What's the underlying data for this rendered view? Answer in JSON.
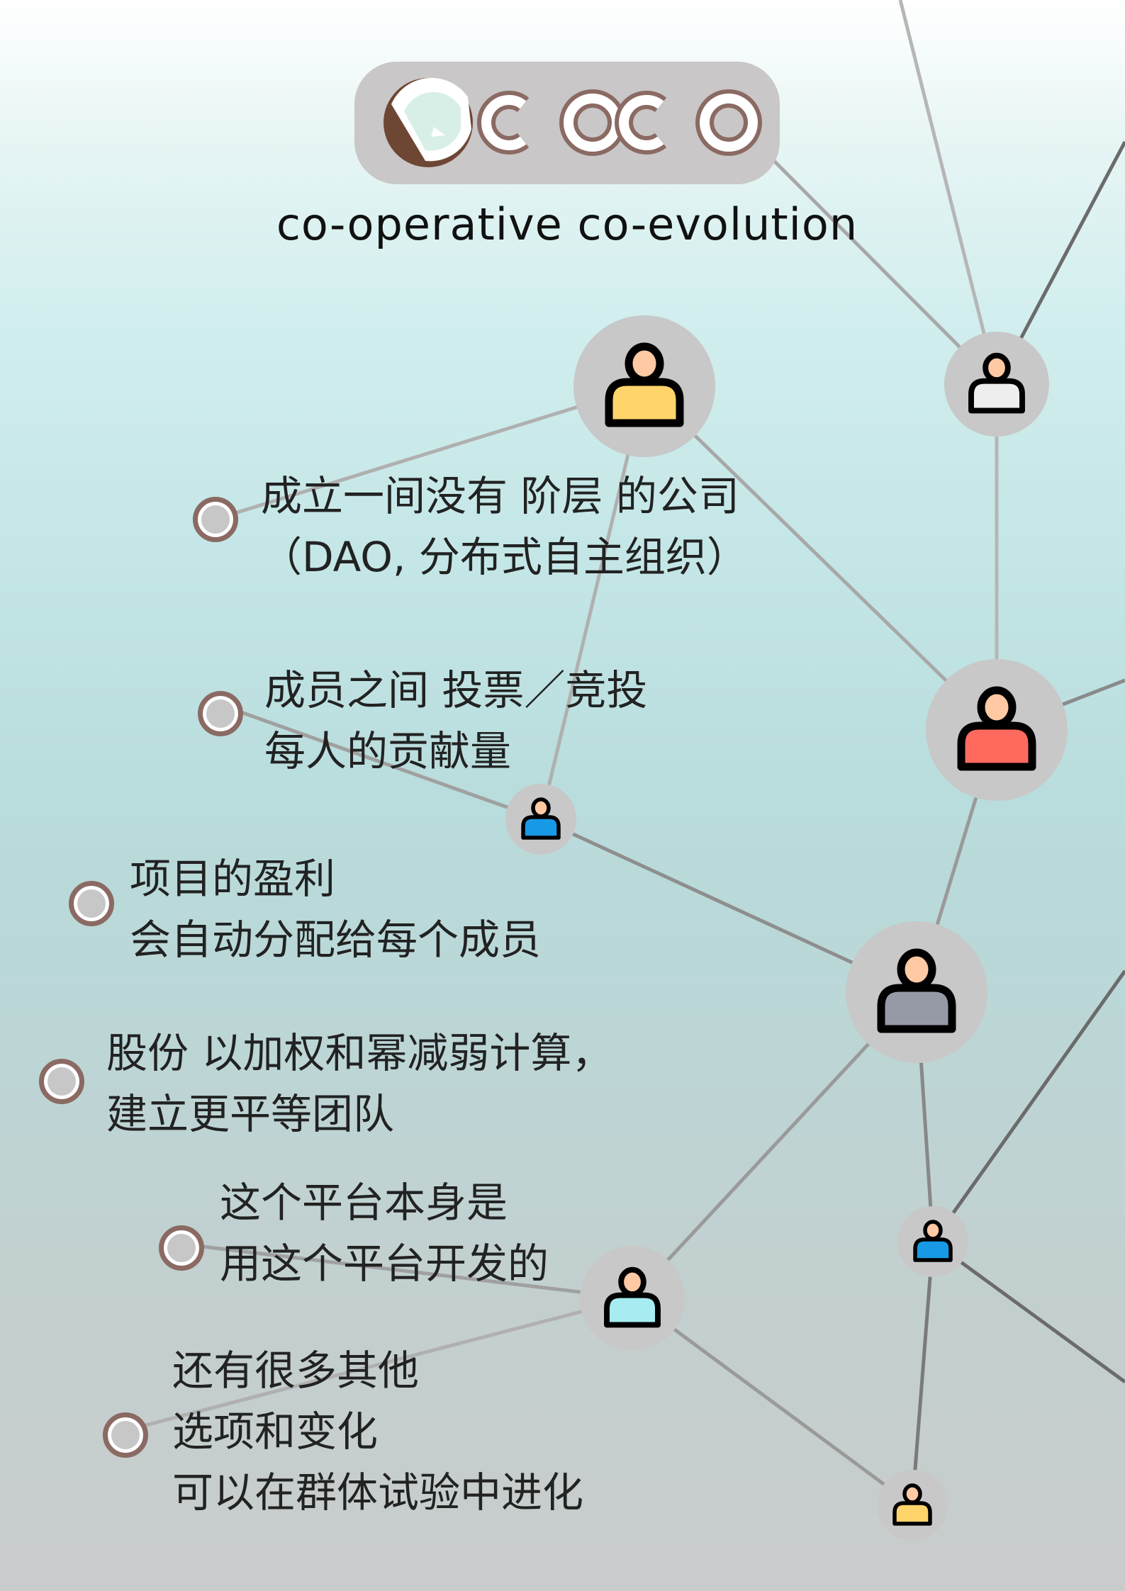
{
  "logo": {
    "icon": "coconut-icon",
    "wordmark": "COCO"
  },
  "slogan": "co-operative co-evolution",
  "features": [
    {
      "lines": [
        "成立一间没有 阶层 的公司",
        "（DAO, 分布式自主组织）"
      ]
    },
    {
      "lines": [
        "成员之间 投票／竞投",
        "每人的贡献量"
      ]
    },
    {
      "lines": [
        "项目的盈利",
        "会自动分配给每个成员"
      ]
    },
    {
      "lines": [
        "股份 以加权和幂减弱计算，",
        "建立更平等团队"
      ]
    },
    {
      "lines": [
        "这个平台本身是",
        "用这个平台开发的"
      ]
    },
    {
      "lines": [
        "还有很多其他",
        "选项和变化",
        "可以在群体试验中进化"
      ]
    }
  ],
  "network": {
    "icon": "person-icon",
    "shirt_colors": {
      "yellow": "#ffd56b",
      "white": "#eeeeee",
      "red": "#ff6a5f",
      "blue": "#1899e6",
      "gray": "#969aa6",
      "cyan": "#a6ecf0"
    },
    "skin_color": "#ffc9a3",
    "halo_color": "#c8c8c8",
    "bullet_colors": {
      "fill": "#c7c7c7",
      "ring": "#8a6a63"
    }
  }
}
